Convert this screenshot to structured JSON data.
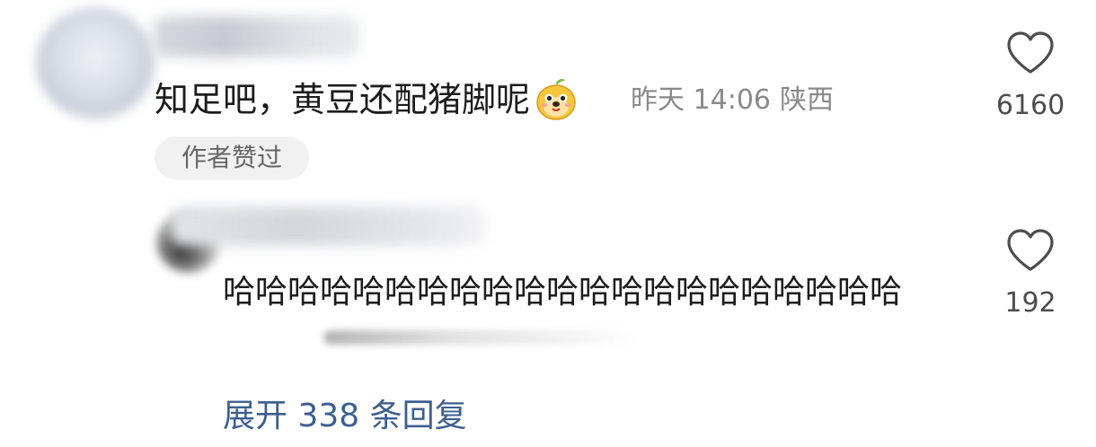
{
  "top_comment": {
    "username": "",
    "text": "知足吧，黄豆还配猪脚呢",
    "sticker_icon": "doge-face-sticker",
    "time": "昨天 14:06",
    "location": "陕西",
    "badge": "作者赞过",
    "likes": "6160"
  },
  "reply": {
    "username": "",
    "text": "哈哈哈哈哈哈哈哈哈哈哈哈哈哈哈哈哈哈哈哈哈",
    "likes": "192"
  },
  "expand_label": "展开 338 条回复",
  "colors": {
    "text": "#1c1c1c",
    "meta": "#8a8a8a",
    "link": "#3d5f8f",
    "badge_bg": "#f1f1f1"
  }
}
